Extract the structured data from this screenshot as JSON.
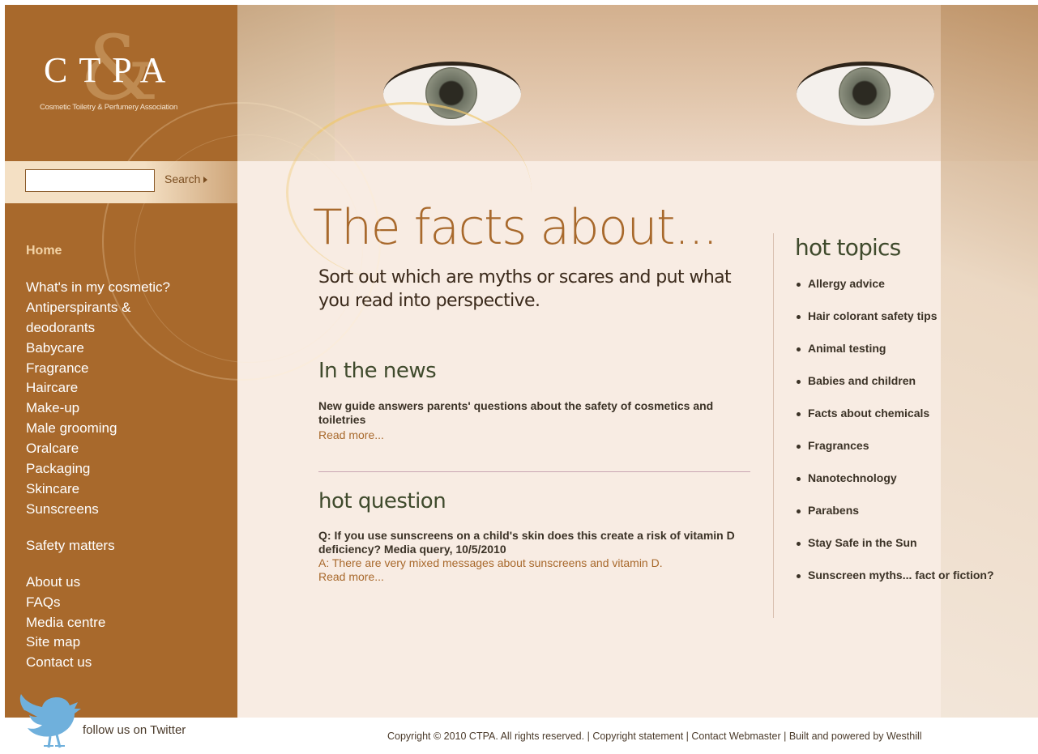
{
  "logo": {
    "letters": "CTPA",
    "tagline": "Cosmetic Toiletry & Perfumery Association"
  },
  "search": {
    "placeholder": "",
    "button_label": "Search"
  },
  "nav": {
    "home": "Home",
    "group1": [
      "What's in my cosmetic?",
      "Antiperspirants &",
      "deodorants",
      "Babycare",
      "Fragrance",
      "Haircare",
      "Make-up",
      "Male grooming",
      "Oralcare",
      "Packaging",
      "Skincare",
      "Sunscreens"
    ],
    "group2": [
      "Safety matters"
    ],
    "group3": [
      "About us",
      "FAQs",
      "Media centre",
      "Site map",
      "Contact us"
    ]
  },
  "twitter": {
    "label": "follow us on Twitter"
  },
  "main": {
    "headline": "The facts about...",
    "subhead": "Sort out which are myths or scares and put what you read into perspective.",
    "news": {
      "heading": "In the news",
      "title": "New guide answers parents' questions about the safety of cosmetics and toiletries",
      "read_more": "Read more..."
    },
    "question": {
      "heading": "hot question",
      "title": "Q: If you use sunscreens on a child's skin does this create a risk of vitamin D deficiency? Media query, 10/5/2010",
      "answer": "A: There are very mixed messages about sunscreens and vitamin D.",
      "read_more": "Read more..."
    }
  },
  "topics": {
    "heading": "hot topics",
    "items": [
      "Allergy advice",
      "Hair colorant safety tips",
      "Animal testing",
      "Babies and children",
      "Facts about chemicals",
      "Fragrances",
      "Nanotechnology",
      "Parabens",
      "Stay Safe in the Sun",
      "Sunscreen myths... fact or fiction?"
    ]
  },
  "footer": {
    "copyright": "Copyright © 2010 CTPA. All rights reserved.",
    "links": [
      "Copyright statement",
      "Contact Webmaster",
      "Built and powered by Westhill"
    ],
    "separator": " | "
  },
  "colors": {
    "brand_brown": "#a8692c",
    "heading_green": "#3f4a2c",
    "text_dark": "#3b3226"
  }
}
